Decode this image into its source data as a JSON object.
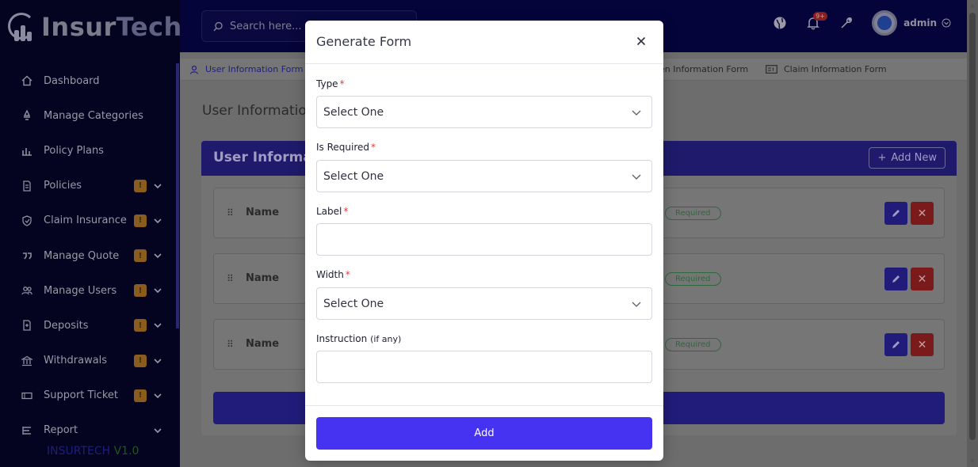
{
  "brand": {
    "logo_a": "Insur",
    "logo_b": "Tech"
  },
  "sidebar": {
    "items": [
      {
        "label": "Dashboard",
        "icon": "home-icon",
        "badge": "",
        "caret": false
      },
      {
        "label": "Manage Categories",
        "icon": "categories-icon",
        "badge": "",
        "caret": false
      },
      {
        "label": "Policy Plans",
        "icon": "chart-bars-icon",
        "badge": "",
        "caret": false
      },
      {
        "label": "Policies",
        "icon": "document-icon",
        "badge": "!",
        "caret": true
      },
      {
        "label": "Claim Insurance",
        "icon": "shield-icon",
        "badge": "!",
        "caret": true
      },
      {
        "label": "Manage Quote",
        "icon": "quote-icon",
        "badge": "!",
        "caret": true
      },
      {
        "label": "Manage Users",
        "icon": "users-icon",
        "badge": "!",
        "caret": true
      },
      {
        "label": "Deposits",
        "icon": "deposit-icon",
        "badge": "!",
        "caret": true
      },
      {
        "label": "Withdrawals",
        "icon": "bank-icon",
        "badge": "!",
        "caret": true
      },
      {
        "label": "Support Ticket",
        "icon": "ticket-icon",
        "badge": "!",
        "caret": true
      },
      {
        "label": "Report",
        "icon": "report-icon",
        "badge": "",
        "caret": true
      }
    ],
    "version_name": "INSURTECH",
    "version_num": "V1.0"
  },
  "header": {
    "search_placeholder": "Search here...",
    "notif_count": "9+",
    "username": "admin"
  },
  "tabs": [
    {
      "label": "User Information Form",
      "active": true
    },
    {
      "label": "en Information Form",
      "active": false
    },
    {
      "label": "Claim Information Form",
      "active": false
    }
  ],
  "page": {
    "title": "User Information",
    "panel_title": "User Informati",
    "add_new": "Add New",
    "rows": [
      {
        "name": "Name",
        "status": "Required"
      },
      {
        "name": "Name",
        "status": "Required"
      },
      {
        "name": "Name",
        "status": "Required"
      }
    ]
  },
  "modal": {
    "title": "Generate Form",
    "fields": {
      "type": {
        "label": "Type",
        "value": "Select One"
      },
      "required": {
        "label": "Is Required",
        "value": "Select One"
      },
      "label": {
        "label": "Label",
        "value": ""
      },
      "width": {
        "label": "Width",
        "value": "Select One"
      },
      "instruction": {
        "label": "Instruction",
        "sublabel": "(if any)",
        "value": ""
      }
    },
    "submit": "Add"
  },
  "colors": {
    "accent": "#4633f2",
    "sidebar": "#040320",
    "required": "#e03a3a"
  }
}
